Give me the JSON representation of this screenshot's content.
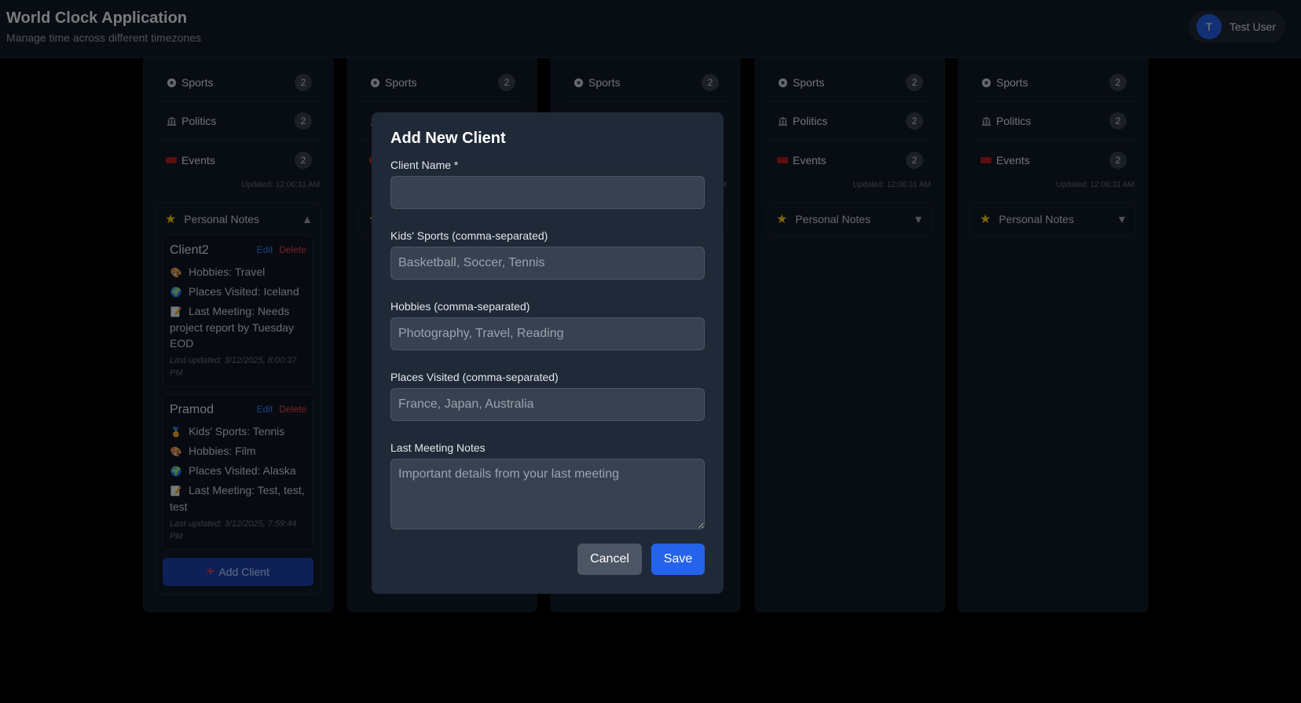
{
  "header": {
    "title": "World Clock Application",
    "subtitle": "Manage time across different timezones",
    "user": {
      "initial": "T",
      "name": "Test User"
    }
  },
  "categories": [
    {
      "name": "Sports",
      "count": "2",
      "icon": "soccer-ball-icon"
    },
    {
      "name": "Politics",
      "count": "2",
      "icon": "government-building-icon"
    },
    {
      "name": "Events",
      "count": "2",
      "icon": "ticket-icon"
    }
  ],
  "updated_text": "Updated: 12:06:31 AM",
  "notes": {
    "title": "Personal Notes",
    "expanded_caret": "▲",
    "collapsed_caret": "▼",
    "edit_label": "Edit",
    "delete_label": "Delete",
    "add_client_label": "Add Client",
    "clients": [
      {
        "name": "Client2",
        "details": [
          {
            "icon": "palette-icon",
            "text": "Hobbies: Travel"
          },
          {
            "icon": "globe-icon",
            "text": "Places Visited: Iceland"
          },
          {
            "icon": "memo-icon",
            "text": "Last Meeting: Needs project report by Tuesday EOD"
          }
        ],
        "last_updated": "Last updated: 3/12/2025, 8:00:37 PM"
      },
      {
        "name": "Pramod",
        "details": [
          {
            "icon": "medal-icon",
            "text": "Kids' Sports: Tennis"
          },
          {
            "icon": "palette-icon",
            "text": "Hobbies: Film"
          },
          {
            "icon": "globe-icon",
            "text": "Places Visited: Alaska"
          },
          {
            "icon": "memo-icon",
            "text": "Last Meeting: Test, test, test"
          }
        ],
        "last_updated": "Last updated: 3/12/2025, 7:59:44 PM"
      }
    ]
  },
  "modal": {
    "title": "Add New Client",
    "client_name_label": "Client Name *",
    "client_name_value": "",
    "kids_sports_label": "Kids' Sports (comma-separated)",
    "kids_sports_placeholder": "Basketball, Soccer, Tennis",
    "hobbies_label": "Hobbies (comma-separated)",
    "hobbies_placeholder": "Photography, Travel, Reading",
    "places_label": "Places Visited (comma-separated)",
    "places_placeholder": "France, Japan, Australia",
    "notes_label": "Last Meeting Notes",
    "notes_placeholder": "Important details from your last meeting",
    "cancel_label": "Cancel",
    "save_label": "Save"
  },
  "colors": {
    "background": "#000000",
    "panel": "#111827",
    "modal": "#1f2937",
    "accent": "#2563eb",
    "danger": "#ef4444",
    "star": "#facc15"
  }
}
